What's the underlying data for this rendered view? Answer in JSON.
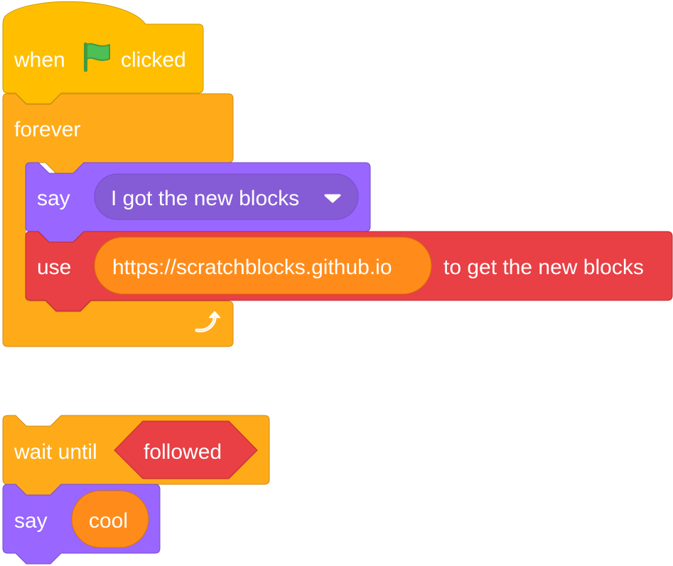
{
  "stack1": {
    "hat": {
      "when": "when",
      "clicked": "clicked",
      "flag_icon": "green-flag-icon"
    },
    "forever": {
      "label": "forever",
      "loop_icon": "loop-arrow-icon"
    },
    "say": {
      "label": "say",
      "message": "I got the new blocks",
      "dropdown_icon": "caret-down-icon"
    },
    "use": {
      "label": "use",
      "url": "https://scratchblocks.github.io",
      "suffix": "to get the new blocks"
    }
  },
  "stack2": {
    "wait": {
      "label": "wait until",
      "condition": "followed"
    },
    "say": {
      "label": "say",
      "message": "cool"
    }
  },
  "colors": {
    "events": "#ffbf00",
    "events_stroke": "#cc9900",
    "control": "#ffab19",
    "control_stroke": "#cf8b17",
    "looks": "#9966ff",
    "looks_stroke": "#774dcb",
    "looks_reporter": "#855cd6",
    "custom": "#e84045",
    "custom_stroke": "#c1272d",
    "operator_orange": "#ff8c1a",
    "operator_orange_stroke": "#db6e00",
    "flag_green": "#4cbf56",
    "flag_dark": "#45993d"
  }
}
